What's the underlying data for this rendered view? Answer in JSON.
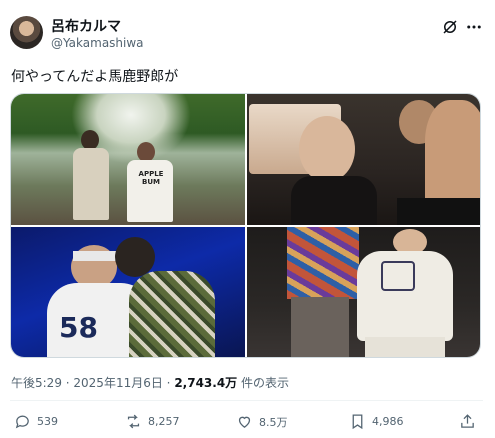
{
  "author": {
    "name": "呂布カルマ",
    "handle": "@Yakamashiwa"
  },
  "tweet": {
    "text": "何やってんだよ馬鹿野郎が"
  },
  "photos": {
    "p1_shirt_text": "APPLE\nBUM",
    "p3_jersey_number": "58"
  },
  "meta": {
    "time": "午後5:29",
    "sep1": " · ",
    "date": "2025年11月6日",
    "sep2": " · ",
    "views": "2,743.4万",
    "views_suffix": " 件の表示"
  },
  "actions": {
    "replies": "539",
    "reposts": "8,257",
    "likes": "8.5万",
    "bookmarks": "4,986"
  },
  "colors": {
    "text": "#0f1419",
    "secondary": "#536471",
    "border": "#cfd9de"
  }
}
